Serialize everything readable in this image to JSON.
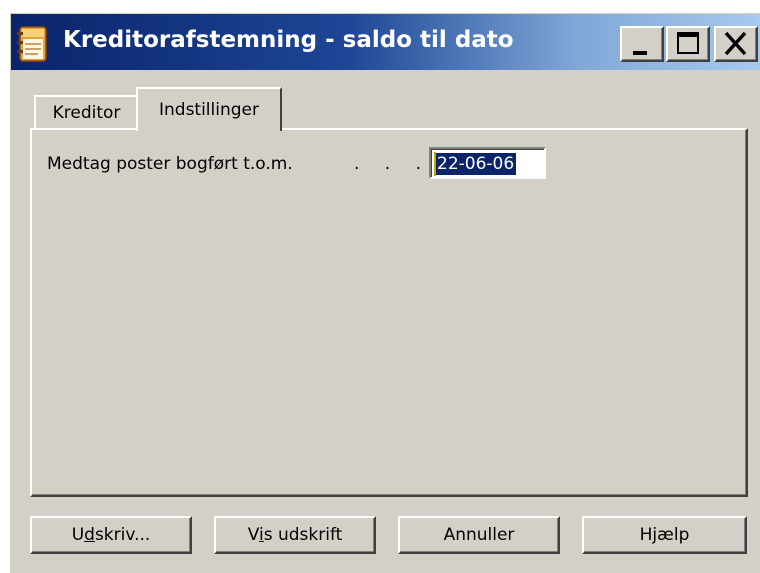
{
  "window": {
    "title": "Kreditorafstemning - saldo til dato",
    "icon": "notebook-app-icon"
  },
  "caption_buttons": {
    "minimize_icon": "minimize-icon",
    "maximize_icon": "maximize-icon",
    "close_icon": "close-icon"
  },
  "tabs": [
    {
      "label": "Kreditor",
      "active": false
    },
    {
      "label": "Indstillinger",
      "active": true
    }
  ],
  "form": {
    "field_label": "Medtag poster bogført t.o.m.",
    "leader_dots": ". . . . .",
    "date_value": "22-06-06"
  },
  "buttons": {
    "print": {
      "pre": "U",
      "mnemonic": "d",
      "post": "skriv..."
    },
    "preview": {
      "pre": "V",
      "mnemonic": "i",
      "post": "s udskrift"
    },
    "cancel": {
      "label": "Annuller"
    },
    "help": {
      "label": "Hjælp"
    }
  },
  "colors": {
    "title_gradient_start": "#0a246a",
    "title_gradient_end": "#a6caf0",
    "face": "#d4d0c8",
    "selection": "#0a246a"
  }
}
